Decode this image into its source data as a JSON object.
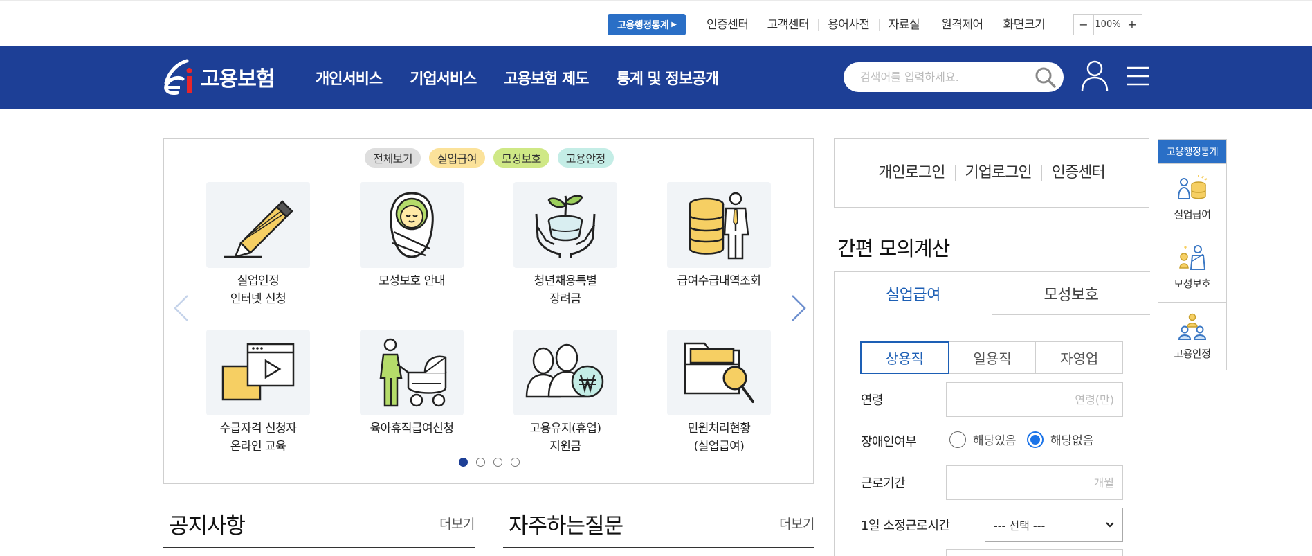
{
  "topbar": {
    "stat_button": "고용행정통계",
    "links": [
      "인증센터",
      "고객센터",
      "용어사전",
      "자료실",
      "원격제어",
      "화면크기"
    ],
    "zoom": {
      "minus": "−",
      "value": "100%",
      "plus": "+"
    }
  },
  "header": {
    "logo_text": "고용보험",
    "nav": [
      "개인서비스",
      "기업서비스",
      "고용보험 제도",
      "통계 및 정보공개"
    ],
    "search_placeholder": "검색어를 입력하세요."
  },
  "quick_menu": {
    "filters": [
      {
        "label": "전체보기",
        "color": "#dedede"
      },
      {
        "label": "실업급여",
        "color": "#fbe29a"
      },
      {
        "label": "모성보호",
        "color": "#cfe886"
      },
      {
        "label": "고용안정",
        "color": "#c4ede6"
      }
    ],
    "items": [
      {
        "line1": "실업인정",
        "line2": "인터넷 신청",
        "icon": "pencil-icon"
      },
      {
        "line1": "모성보호 안내",
        "line2": "",
        "icon": "baby-icon"
      },
      {
        "line1": "청년채용특별",
        "line2": "장려금",
        "icon": "plant-hands-icon"
      },
      {
        "line1": "급여수급내역조회",
        "line2": "",
        "icon": "coins-person-icon"
      },
      {
        "line1": "수급자격 신청자",
        "line2": "온라인 교육",
        "icon": "video-icon"
      },
      {
        "line1": "육아휴직급여신청",
        "line2": "",
        "icon": "stroller-icon"
      },
      {
        "line1": "고용유지(휴업)",
        "line2": "지원금",
        "icon": "people-won-icon"
      },
      {
        "line1": "민원처리현황",
        "line2": "(실업급여)",
        "icon": "folder-search-icon"
      }
    ],
    "pages": 4,
    "current_page": 1
  },
  "boards": {
    "notice_title": "공지사항",
    "faq_title": "자주하는질문",
    "more_label": "더보기"
  },
  "login": {
    "links": [
      "개인로그인",
      "기업로그인",
      "인증센터"
    ]
  },
  "calculator": {
    "title": "간편 모의계산",
    "tabs": [
      "실업급여",
      "모성보호"
    ],
    "work_types": [
      "상용직",
      "일용직",
      "자영업"
    ],
    "age_label": "연령",
    "age_placeholder": "연령(만)",
    "disability_label": "장애인여부",
    "disability_yes": "해당있음",
    "disability_no": "해당없음",
    "period_label": "근로기간",
    "period_placeholder": "개월",
    "hours_label": "1일 소정근로시간",
    "hours_value": "--- 선택 ---"
  },
  "side_menu": {
    "header": "고용행정통계",
    "items": [
      "실업급여",
      "모성보호",
      "고용안정"
    ]
  },
  "colors": {
    "header_bg": "#1d3f96",
    "accent_blue": "#2a6fc6",
    "tab_active": "#1d5fb5"
  }
}
